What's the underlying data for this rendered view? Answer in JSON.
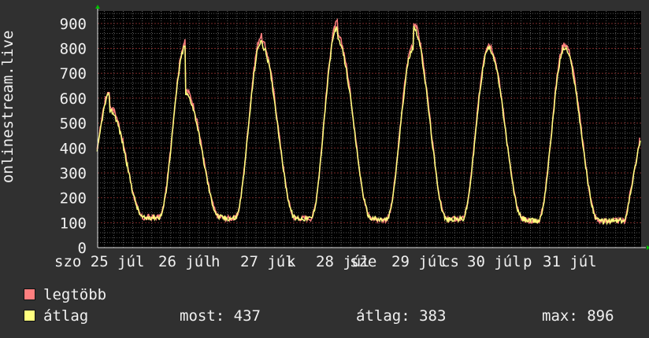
{
  "chart_data": {
    "type": "line",
    "ylabel": "onlinestream.live",
    "y_ticks": [
      "0",
      "100",
      "200",
      "300",
      "400",
      "500",
      "600",
      "700",
      "800",
      "900"
    ],
    "ylim": [
      0,
      950
    ],
    "x_ticks": [
      "szo 25 júl",
      "26 júl",
      "27 júl",
      "28 júl",
      "29 júl",
      "30 júl",
      "31 júl"
    ],
    "x_ticks_overlap": [
      "h",
      "k",
      "sze",
      "cs",
      "p"
    ],
    "grid": true,
    "colors": {
      "background": "#000000",
      "outer": "#303030",
      "grid": "#5a5a5a",
      "major_grid": "#7a2a2a",
      "legtobb": "#ff7f7f",
      "atlag": "#ffff7f",
      "arrow": "#00c000"
    },
    "series": [
      {
        "name": "legtöbb",
        "color": "#ff7f7f",
        "peaks_days": [
          0.1,
          1.1,
          2.1,
          3.1,
          4.1,
          5.1,
          6.1
        ],
        "peak_values": [
          565,
          632,
          828,
          851,
          905,
          815,
          818
        ],
        "trough_values": [
          118,
          123,
          118,
          118,
          113,
          115,
          108
        ],
        "end_value": 445
      },
      {
        "name": "átlag",
        "color": "#ffff7f",
        "peak_values": [
          550,
          615,
          810,
          830,
          886,
          800,
          800
        ],
        "trough_values": [
          118,
          122,
          118,
          117,
          112,
          114,
          107
        ],
        "end_value": 437
      }
    ]
  },
  "legend": {
    "legtobb": "legtöbb",
    "atlag": "átlag"
  },
  "stats": {
    "most": "most: 437",
    "atlag": "átlag: 383",
    "max": "max: 896"
  }
}
